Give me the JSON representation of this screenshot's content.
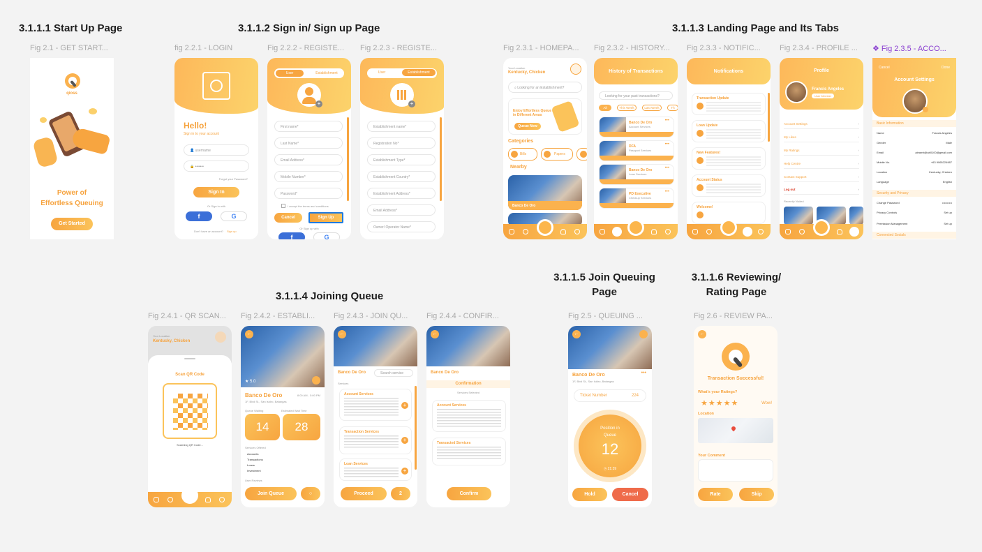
{
  "sections": {
    "s1": "3.1.1.1 Start Up Page",
    "s2": "3.1.1.2 Sign in/ Sign up Page",
    "s3": "3.1.1.3 Landing Page and Its Tabs",
    "s4": "3.1.1.4 Joining Queue",
    "s5a": "3.1.1.5 Join Queuing",
    "s5b": "Page",
    "s6a": "3.1.1.6 Reviewing/",
    "s6b": "Rating Page"
  },
  "captions": {
    "f21": "Fig 2.1 - GET START...",
    "f221": "fig 2.2.1 - LOGIN",
    "f222": "Fig 2.2.2 - REGISTE...",
    "f223": "Fig 2.2.3 - REGISTE...",
    "f231": "Fig 2.3.1 - HOMEPA...",
    "f232": "Fig 2.3.2 - HISTORY...",
    "f233": "Fig 2.3.3 - NOTIFIC...",
    "f234": "Fig 2.3.4 - PROFILE ...",
    "f235": "❖ Fig 2.3.5 - ACCO...",
    "f241": "Fig 2.4.1 - QR SCAN...",
    "f242": "Fig 2.4.2 - ESTABLI...",
    "f243": "Fig 2.4.3 - JOIN QU...",
    "f244": "Fig 2.4.4 - CONFIR...",
    "f25": "Fig 2.5 - QUEUING ...",
    "f26": "Fig 2.6 - REVIEW PA..."
  },
  "startup": {
    "brand": "qioss",
    "tagline1": "Power of",
    "tagline2": "Effortless Queuing",
    "cta": "Get Started"
  },
  "login": {
    "hello": "Hello!",
    "sub": "Sign in to your account",
    "user": "username",
    "pass": "•••••••",
    "forgot": "Forgot your Password?",
    "signin": "Sign In",
    "or": "Or Sign in with",
    "noacc": "Don't have an account?",
    "signup": "Sign up"
  },
  "reg_user": {
    "tab1": "User",
    "tab2": "Establishment",
    "fields": [
      "First name*",
      "Last Name*",
      "Email Address*",
      "Mobile Number*",
      "Password*"
    ],
    "agree": "I accept the terms and conditions",
    "cancel": "Cancel",
    "signup": "Sign Up",
    "or": "Or Sign up with"
  },
  "reg_est": {
    "tab1": "User",
    "tab2": "Establishment",
    "fields": [
      "Establishment name*",
      "Registration No*",
      "Establishment Type*",
      "Establishment Country*",
      "Establishment Address*",
      "Email Address*",
      "Owner/ Operator Name*"
    ]
  },
  "home": {
    "loc_label": "Your Location",
    "loc": "Kentucky, Chicken",
    "search": "Looking for an Establishment?",
    "promo1": "Enjoy Effortless Queue",
    "promo2": "in Different Areas",
    "promo_btn": "Queue Now",
    "categories": "Categories",
    "cat1": "Bills",
    "cat2": "Papers",
    "nearby": "Nearby",
    "place": "Banco De Oro"
  },
  "history": {
    "title": "History of Transactions",
    "search": "Looking for your past transactions?",
    "chips": [
      "All",
      "This Week",
      "Last Week",
      "Th"
    ],
    "items": [
      {
        "name": "Banco De Oro",
        "sub": "Account Services"
      },
      {
        "name": "DFA",
        "sub": "Passport Services"
      },
      {
        "name": "Banco De Oro",
        "sub": "Loan Services"
      },
      {
        "name": "PD Executive",
        "sub": "Checkup Services"
      }
    ]
  },
  "notif": {
    "title": "Notifications",
    "items": [
      "Transaction Update",
      "Loan Update",
      "New Features!",
      "Account Status",
      "Welcome!"
    ]
  },
  "profile": {
    "title": "Profile",
    "name": "Francis Angeles",
    "badge": "User Member",
    "items": [
      "Account Settings",
      "My Likes",
      "My Ratings",
      "Help Centre",
      "Contact Support",
      "Log out"
    ],
    "recent": "Recently Visited"
  },
  "account": {
    "cancel": "Cancel",
    "done": "Done",
    "title": "Account Settings",
    "basic": "Basic Information",
    "rows": [
      [
        "Name",
        "Francis Angeles"
      ],
      [
        "Gender",
        "Male"
      ],
      [
        "Email",
        "aleanvt@ab0100@gmail.com"
      ],
      [
        "Mobile No.",
        "+63 9065224987"
      ],
      [
        "Location",
        "Kentucky, Chicken"
      ],
      [
        "Language",
        "English"
      ]
    ],
    "security": "Security and Privacy",
    "srows": [
      [
        "Change Password",
        "••••••••••"
      ],
      [
        "Privacy Controls",
        "Set up"
      ],
      [
        "Permission Management",
        "Set up"
      ]
    ],
    "connected": "Connected Socials"
  },
  "qr": {
    "loc_label": "Your Location",
    "loc": "Kentucky, Chicken",
    "title": "Scan QR Code",
    "scanning": "Scanning QR Code..."
  },
  "est": {
    "rating": "5.0",
    "name": "Banco De Oro",
    "addr": "1F, Blvd St., San Isidro, Batangas",
    "hours": "8:00 AM - 5:00 PM",
    "qw_label": "Queue Waiting",
    "qw": "14",
    "wait_label": "Estimated Wait Time",
    "wait": "28",
    "offered": "Services Offered",
    "services": [
      "Accounts",
      "Transactions",
      "Loans",
      "Investment"
    ],
    "reviews": "User Reviews",
    "join": "Join Queue"
  },
  "joinq": {
    "name": "Banco De Oro",
    "search": "Search service",
    "services": "Services",
    "items": [
      "Account Services",
      "Transaction Services",
      "Loan Services"
    ],
    "proceed": "Proceed",
    "count": "2"
  },
  "confirm": {
    "name": "Banco De Oro",
    "title": "Confirmation",
    "selected": "Services Selected",
    "items": [
      "Account Services",
      "Transacted Services"
    ],
    "confirm": "Confirm"
  },
  "queue": {
    "name": "Banco De Oro",
    "addr": "1F, Blvd St., San Isidro, Batangas",
    "ticket_label": "Ticket Number",
    "ticket": "224",
    "pos1": "Position in",
    "pos2": "Queue",
    "pos": "12",
    "time": "21:39",
    "hold": "Hold",
    "cancel": "Cancel"
  },
  "review": {
    "success": "Transaction Successful!",
    "ratings": "What's your Ratings?",
    "wow": "Wow!",
    "stars": 5,
    "location": "Location",
    "comment": "Your Comment",
    "rate": "Rate",
    "skip": "Skip"
  }
}
